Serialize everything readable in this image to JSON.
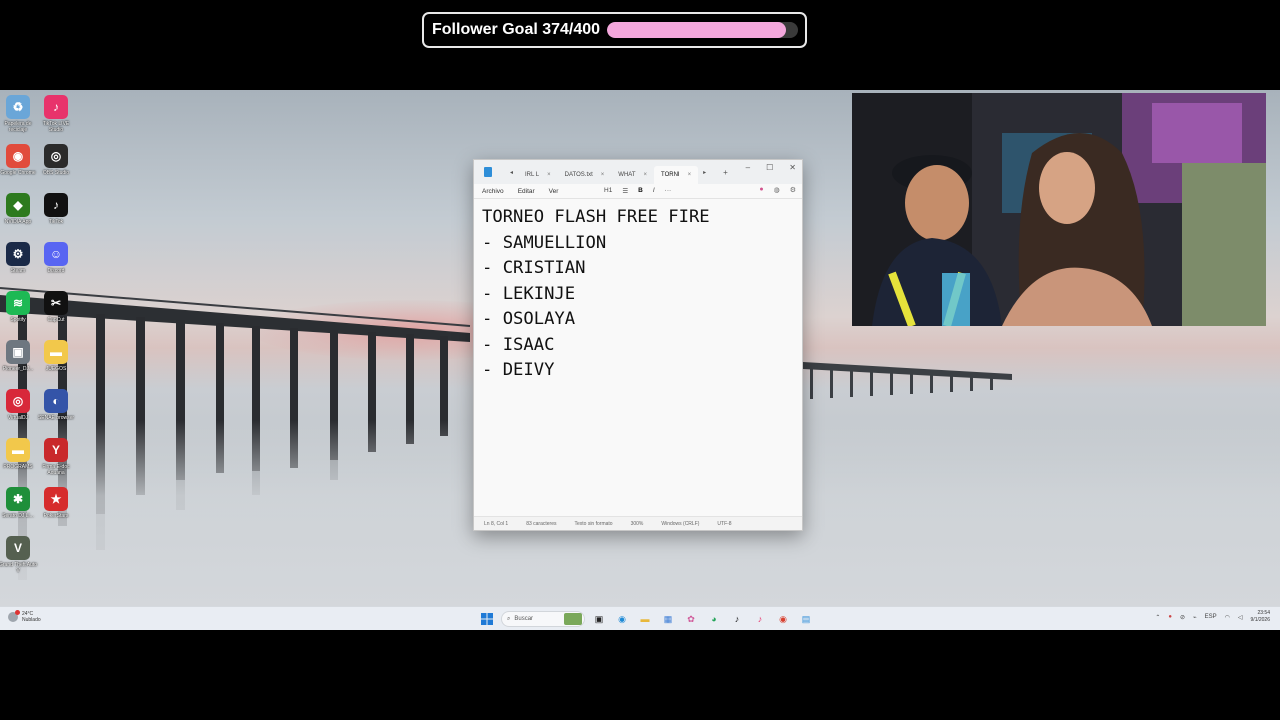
{
  "overlay": {
    "goal_text": "Follower Goal 374/400",
    "current": 374,
    "target": 400,
    "bar_color": "#f4a7dc"
  },
  "desktop_icons": [
    {
      "name": "recycle-bin-icon",
      "label": "Papelera de reciclaje",
      "color": "#6aa6d8",
      "glyph": "♻"
    },
    {
      "name": "tiktok-live-studio-icon",
      "label": "TikTok LIVE Studio",
      "color": "#e8336b",
      "glyph": "♪"
    },
    {
      "name": "chrome-icon",
      "label": "Google Chrome",
      "color": "#e14b3c",
      "glyph": "◉"
    },
    {
      "name": "obs-studio-icon",
      "label": "OBS Studio",
      "color": "#2b2b2b",
      "glyph": "◎"
    },
    {
      "name": "nvidia-app-icon",
      "label": "NVIDIA App",
      "color": "#2d7a1e",
      "glyph": "◆"
    },
    {
      "name": "tiktok-icon",
      "label": "TikTok",
      "color": "#111111",
      "glyph": "♪"
    },
    {
      "name": "steam-icon",
      "label": "Steam",
      "color": "#1b2a48",
      "glyph": "⚙"
    },
    {
      "name": "discord-icon",
      "label": "Discord",
      "color": "#5865f2",
      "glyph": "☺"
    },
    {
      "name": "spotify-icon",
      "label": "Spotify",
      "color": "#1db954",
      "glyph": "≋"
    },
    {
      "name": "capcut-icon",
      "label": "CapCut",
      "color": "#111111",
      "glyph": "✂"
    },
    {
      "name": "pioneer-icon",
      "label": "Pioneer_DJ...",
      "color": "#6e7780",
      "glyph": "▣"
    },
    {
      "name": "juegos-folder-icon",
      "label": "JUEGOS",
      "color": "#f2c84b",
      "glyph": "▬"
    },
    {
      "name": "virtualdj-icon",
      "label": "VirtualDJ",
      "color": "#d8283a",
      "glyph": "◎"
    },
    {
      "name": "senae-browser-icon",
      "label": "SENAE browser",
      "color": "#3454a8",
      "glyph": "◐"
    },
    {
      "name": "programs-folder-icon",
      "label": "PROGRAMS",
      "color": "#f2c84b",
      "glyph": "▬"
    },
    {
      "name": "firma-edoc-icon",
      "label": "Firma E-doc Aduana",
      "color": "#c9282b",
      "glyph": "Y"
    },
    {
      "name": "serato-icon",
      "label": "Serato DJ Li...",
      "color": "#1f8f3a",
      "glyph": "✱"
    },
    {
      "name": "pokerstars-icon",
      "label": "PokerStars",
      "color": "#d62c2c",
      "glyph": "★"
    },
    {
      "name": "gta-v-icon",
      "label": "Grand Theft Auto V",
      "color": "#556050",
      "glyph": "V"
    }
  ],
  "notepad": {
    "nav_back": "◂",
    "nav_forward": "▸",
    "tabs": [
      {
        "label": "IRL L",
        "active": false
      },
      {
        "label": "DATOS.txt",
        "active": false
      },
      {
        "label": "WHAT",
        "active": false
      },
      {
        "label": "TORNI",
        "active": true
      }
    ],
    "tab_close": "×",
    "tab_add": "+",
    "window_buttons": [
      "–",
      "☐",
      "✕"
    ],
    "menu": [
      "Archivo",
      "Editar",
      "Ver"
    ],
    "tools": [
      "H1",
      "☰",
      "B",
      "I",
      "···"
    ],
    "lines": [
      "TORNEO FLASH FREE FIRE",
      "- SAMUELLION",
      "- CRISTIAN",
      "- LEKINJE",
      "- OSOLAYA",
      "- ISAAC",
      "- DEIVY"
    ],
    "status": [
      "Ln 8, Col 1",
      "83 caracteres",
      "Texto sin formato",
      "300%",
      "Windows (CRLF)",
      "UTF-8"
    ]
  },
  "taskbar": {
    "weather_temp": "24°C",
    "weather_desc": "Nublado",
    "search_placeholder": "Buscar",
    "tray_lang": "ESP",
    "clock_time": "23:54",
    "clock_date": "9/1/2026"
  }
}
